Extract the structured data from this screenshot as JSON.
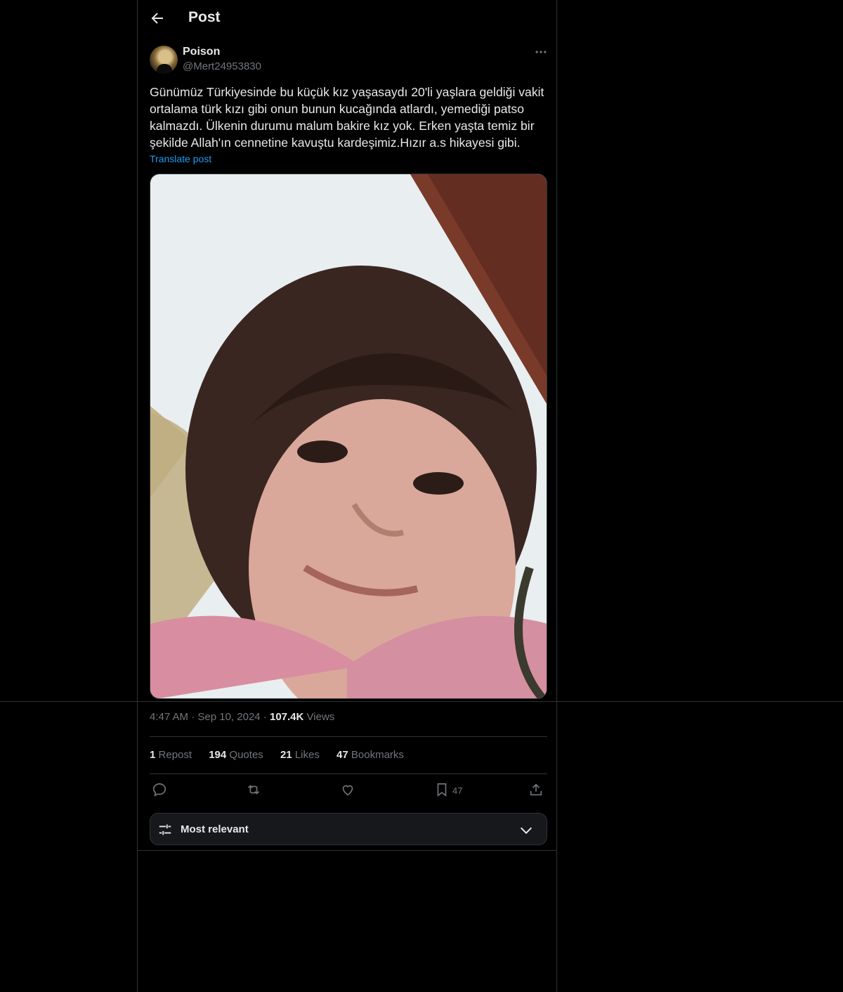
{
  "header": {
    "title": "Post"
  },
  "post": {
    "author_name": "Poison",
    "author_handle": "@Mert24953830",
    "text": "Günümüz Türkiyesinde bu küçük kız yaşasaydı 20'li yaşlara geldiği vakit ortalama türk kızı gibi onun bunun kucağında atlardı, yemediği patso kalmazdı. Ülkenin durumu malum bakire kız yok. Erken yaşta temiz bir şekilde Allah'ın cennetine kavuştu kardeşimiz.Hızır a.s hikayesi gibi.",
    "translate_label": "Translate post",
    "time": "4:47 AM",
    "date": "Sep 10, 2024",
    "views_count": "107.4K",
    "views_label": "Views"
  },
  "stats": [
    {
      "count": "1",
      "label": "Repost"
    },
    {
      "count": "194",
      "label": "Quotes"
    },
    {
      "count": "21",
      "label": "Likes"
    },
    {
      "count": "47",
      "label": "Bookmarks"
    }
  ],
  "actions": {
    "icons": [
      "reply-icon",
      "repost-icon",
      "like-icon",
      "bookmark-icon",
      "share-icon"
    ],
    "bookmark_count": "47"
  },
  "sort": {
    "label": "Most relevant"
  },
  "colors": {
    "background": "#000000",
    "border": "#2f3336",
    "accent": "#1d9bf0",
    "muted": "#71767b"
  }
}
